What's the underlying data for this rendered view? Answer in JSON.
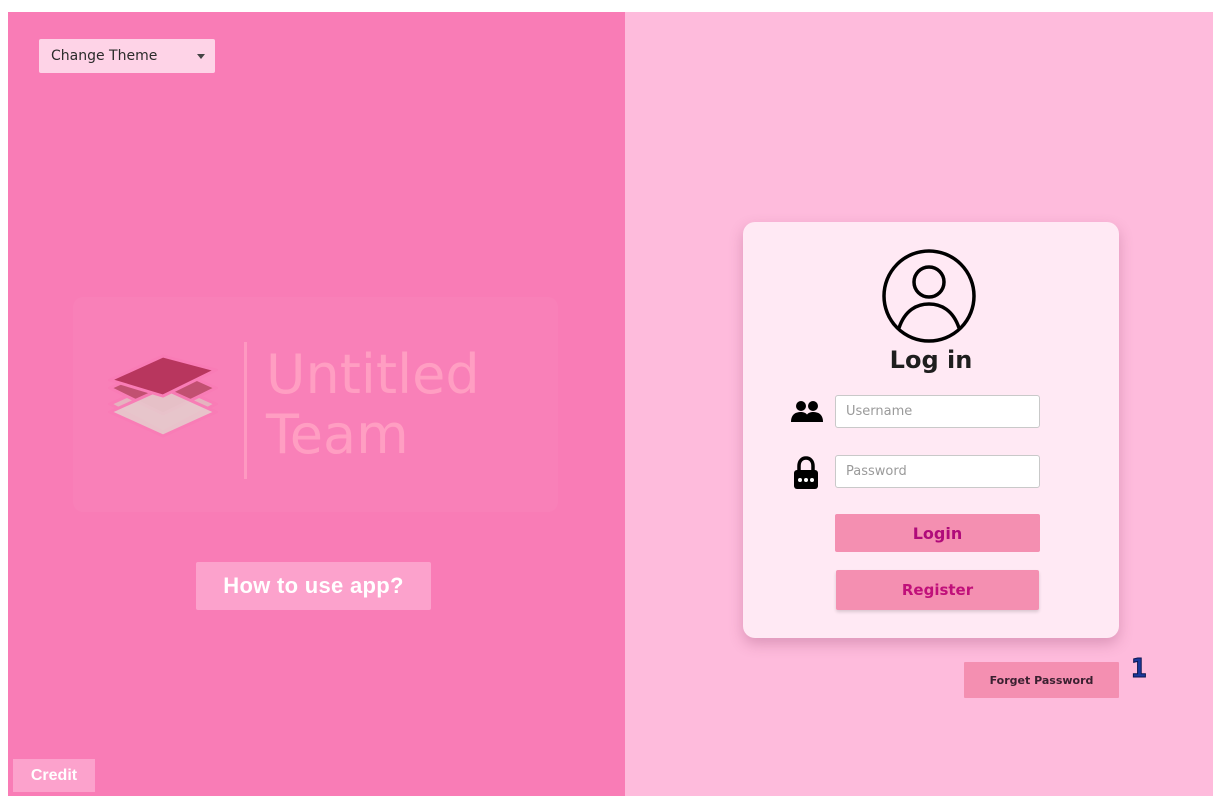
{
  "theme_selector": {
    "label": "Change Theme",
    "icon": "caret-down-icon"
  },
  "brand": {
    "line1": "Untitled",
    "line2": "Team",
    "icon": "stacked-layers-logo"
  },
  "help": {
    "label": "How to use app?"
  },
  "credit": {
    "label": "Credit"
  },
  "login_card": {
    "title": "Log in",
    "avatar_icon": "user-circle-icon",
    "username": {
      "placeholder": "Username",
      "value": "",
      "icon": "users-icon"
    },
    "password": {
      "placeholder": "Password",
      "value": "",
      "icon": "lock-icon"
    },
    "login_label": "Login",
    "register_label": "Register"
  },
  "forget_password": {
    "label": "Forget Password"
  },
  "annotation": {
    "marker": "1"
  },
  "colors": {
    "left_bg": "#f97cb6",
    "right_bg": "#febbdc",
    "card_bg": "#ffe9f4",
    "button_bg": "#f48fb1",
    "button_text": "#b00b7a"
  }
}
